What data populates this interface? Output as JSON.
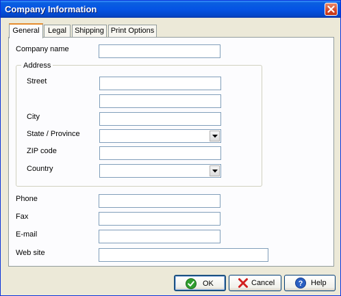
{
  "window": {
    "title": "Company Information"
  },
  "tabs": [
    "General",
    "Legal",
    "Shipping",
    "Print Options"
  ],
  "form": {
    "company_name": {
      "label": "Company name",
      "value": ""
    },
    "address": {
      "group_label": "Address",
      "street_label": "Street",
      "street1": "",
      "street2": "",
      "city_label": "City",
      "city": "",
      "state_label": "State / Province",
      "state": "",
      "zip_label": "ZIP code",
      "zip": "",
      "country_label": "Country",
      "country": ""
    },
    "phone": {
      "label": "Phone",
      "value": ""
    },
    "fax": {
      "label": "Fax",
      "value": ""
    },
    "email": {
      "label": "E-mail",
      "value": ""
    },
    "website": {
      "label": "Web site",
      "value": ""
    }
  },
  "buttons": {
    "ok": "OK",
    "cancel": "Cancel",
    "help": "Help"
  },
  "colors": {
    "titlebar": "#0554e4",
    "dialog_bg": "#ece9d8",
    "active_tab_accent": "#e68b2c",
    "field_border": "#7f9db9"
  }
}
